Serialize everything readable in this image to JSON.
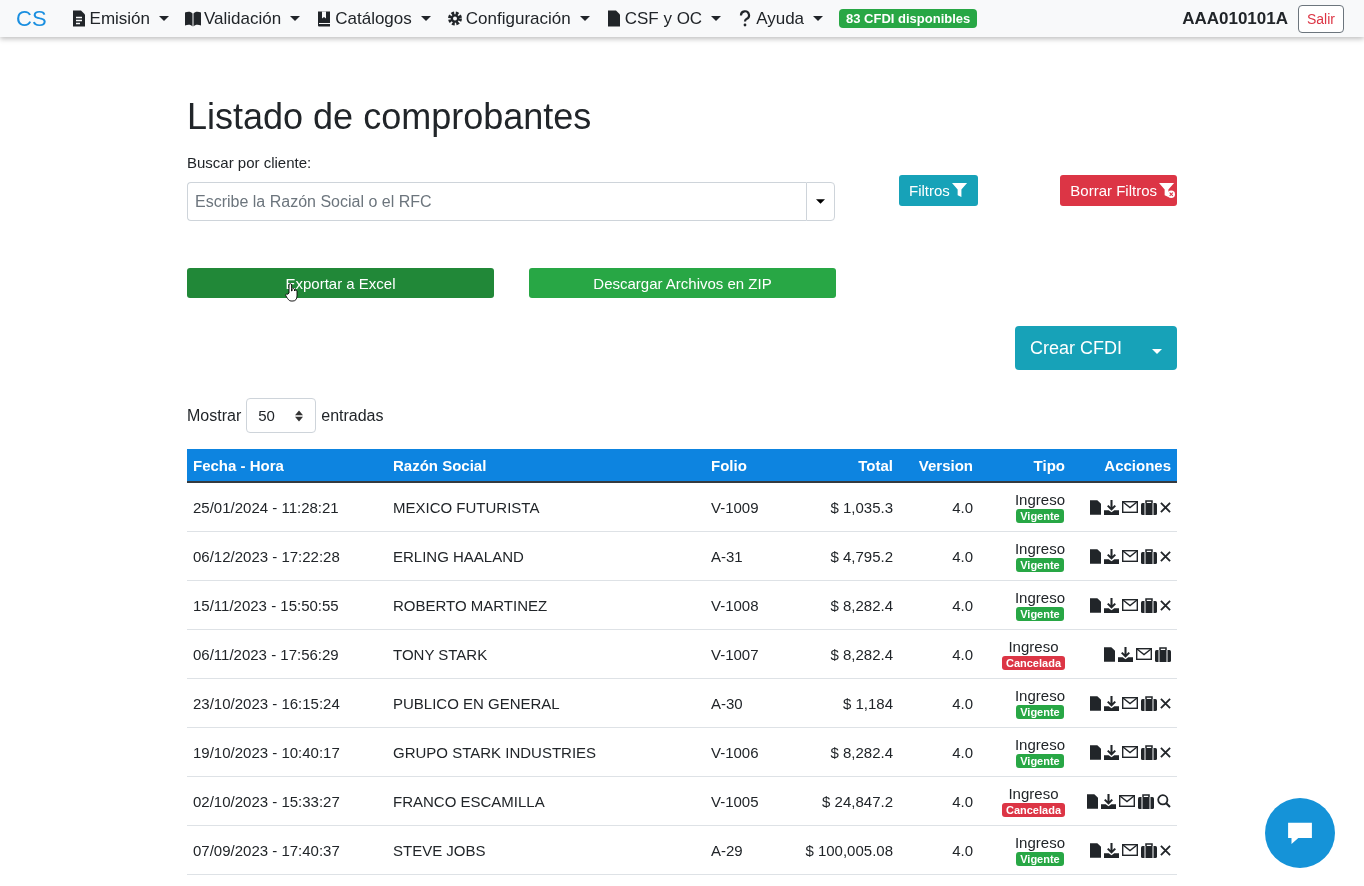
{
  "navbar": {
    "brand": "CS",
    "menus": [
      {
        "label": "Emisión"
      },
      {
        "label": "Validación"
      },
      {
        "label": "Catálogos"
      },
      {
        "label": "Configuración"
      },
      {
        "label": "CSF y OC"
      },
      {
        "label": "Ayuda"
      }
    ],
    "badge": "83 CFDI disponibles",
    "user": "AAA010101A",
    "logout": "Salir"
  },
  "title": "Listado de comprobantes",
  "search": {
    "label": "Buscar por cliente:",
    "placeholder": "Escribe la Razón Social o el RFC"
  },
  "filter_buttons": [
    {
      "label": "Filtros",
      "kind": "filter"
    },
    {
      "label": "Borrar Filtros",
      "kind": "clear"
    }
  ],
  "export_buttons": [
    {
      "label": "Exportar a Excel",
      "hovered": true
    },
    {
      "label": "Descargar Archivos en ZIP",
      "hovered": false
    }
  ],
  "create_button": "Crear CFDI",
  "length": {
    "prefix": "Mostrar",
    "value": "50",
    "suffix": "entradas"
  },
  "table": {
    "columns": [
      "Fecha - Hora",
      "Razón Social",
      "Folio",
      "Total",
      "Version",
      "Tipo",
      "Acciones"
    ],
    "rows": [
      {
        "date": "25/01/2024 - 11:28:21",
        "name": "MEXICO FUTURISTA",
        "folio": "V-1009",
        "total": "$ 1,035.3",
        "version": "4.0",
        "type": "Ingreso",
        "status": {
          "label": "Vigente",
          "kind": "active"
        },
        "kind": "cancelable"
      },
      {
        "date": "06/12/2023 - 17:22:28",
        "name": "ERLING HAALAND",
        "folio": "A-31",
        "total": "$ 4,795.2",
        "version": "4.0",
        "type": "Ingreso",
        "status": {
          "label": "Vigente",
          "kind": "active"
        },
        "kind": "cancelable"
      },
      {
        "date": "15/11/2023 - 15:50:55",
        "name": "ROBERTO MARTINEZ",
        "folio": "V-1008",
        "total": "$ 8,282.4",
        "version": "4.0",
        "type": "Ingreso",
        "status": {
          "label": "Vigente",
          "kind": "active"
        },
        "kind": "cancelable"
      },
      {
        "date": "06/11/2023 - 17:56:29",
        "name": "TONY STARK",
        "folio": "V-1007",
        "total": "$ 8,282.4",
        "version": "4.0",
        "type": "Ingreso",
        "status": {
          "label": "Cancelada",
          "kind": "cancelled"
        },
        "kind": "plain"
      },
      {
        "date": "23/10/2023 - 16:15:24",
        "name": "PUBLICO EN GENERAL",
        "folio": "A-30",
        "total": "$ 1,184",
        "version": "4.0",
        "type": "Ingreso",
        "status": {
          "label": "Vigente",
          "kind": "active"
        },
        "kind": "cancelable"
      },
      {
        "date": "19/10/2023 - 10:40:17",
        "name": "GRUPO STARK INDUSTRIES",
        "folio": "V-1006",
        "total": "$ 8,282.4",
        "version": "4.0",
        "type": "Ingreso",
        "status": {
          "label": "Vigente",
          "kind": "active"
        },
        "kind": "cancelable"
      },
      {
        "date": "02/10/2023 - 15:33:27",
        "name": "FRANCO ESCAMILLA",
        "folio": "V-1005",
        "total": "$ 24,847.2",
        "version": "4.0",
        "type": "Ingreso",
        "status": {
          "label": "Cancelada",
          "kind": "cancelled"
        },
        "kind": "lookup"
      },
      {
        "date": "07/09/2023 - 17:40:37",
        "name": "STEVE JOBS",
        "folio": "A-29",
        "total": "$ 100,005.08",
        "version": "4.0",
        "type": "Ingreso",
        "status": {
          "label": "Vigente",
          "kind": "active"
        },
        "kind": "cancelable"
      }
    ]
  }
}
